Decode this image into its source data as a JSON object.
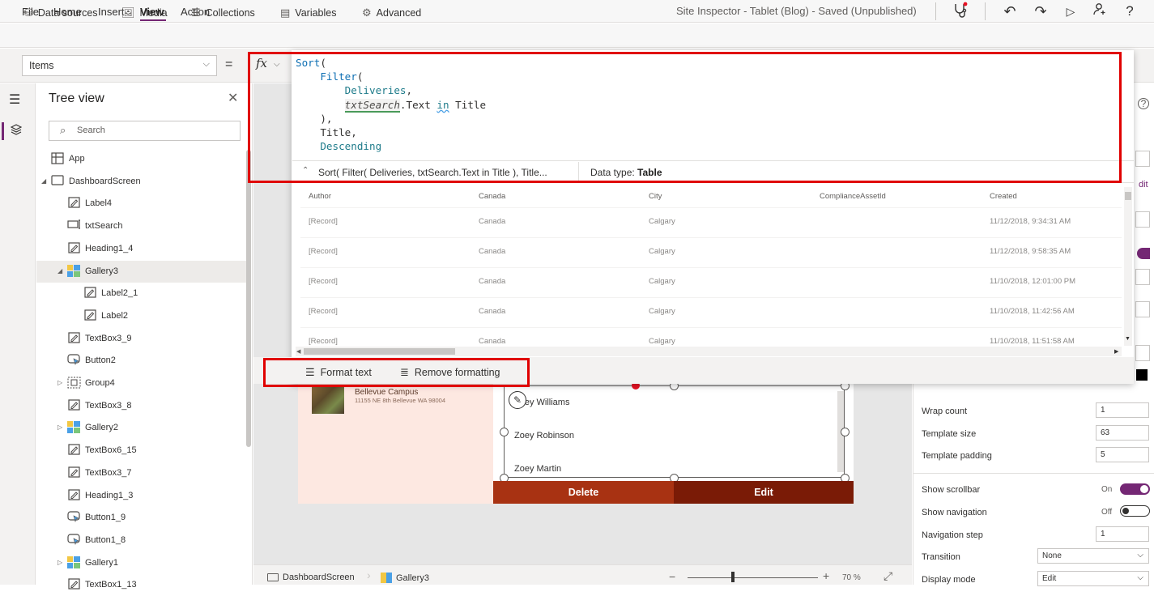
{
  "menubar": {
    "items": [
      "File",
      "Home",
      "Insert",
      "View",
      "Action"
    ],
    "active": "View",
    "doc_title": "Site Inspector - Tablet (Blog) - Saved (Unpublished)"
  },
  "toolbar": {
    "items": [
      {
        "label": "Data sources",
        "icon": "database-icon"
      },
      {
        "label": "Media",
        "icon": "media-icon"
      },
      {
        "label": "Collections",
        "icon": "collections-icon"
      },
      {
        "label": "Variables",
        "icon": "variables-icon"
      },
      {
        "label": "Advanced",
        "icon": "advanced-icon"
      }
    ]
  },
  "formula_bar": {
    "property": "Items",
    "equals": "=",
    "fx": "fx",
    "code_lines": [
      "Sort(",
      "    Filter(",
      "        Deliveries,",
      "        txtSearch.Text in Title",
      "    ),",
      "    Title,",
      "    Descending"
    ],
    "result_expr": "Sort( Filter( Deliveries, txtSearch.Text in Title ), Title...",
    "data_type_label": "Data type:",
    "data_type_value": "Table"
  },
  "result_table": {
    "columns": [
      "Author",
      "Canada",
      "City",
      "ComplianceAssetId",
      "Created"
    ],
    "rows": [
      [
        "[Record]",
        "Canada",
        "Calgary",
        "",
        "11/12/2018, 9:34:31 AM"
      ],
      [
        "[Record]",
        "Canada",
        "Calgary",
        "",
        "11/12/2018, 9:58:35 AM"
      ],
      [
        "[Record]",
        "Canada",
        "Calgary",
        "",
        "11/10/2018, 12:01:00 PM"
      ],
      [
        "[Record]",
        "Canada",
        "Calgary",
        "",
        "11/10/2018, 11:42:56 AM"
      ],
      [
        "[Record]",
        "Canada",
        "Calgary",
        "",
        "11/10/2018, 11:51:58 AM"
      ]
    ]
  },
  "format_bar": {
    "format_text": "Format text",
    "remove_formatting": "Remove formatting"
  },
  "tree": {
    "title": "Tree view",
    "search_placeholder": "Search",
    "items": [
      {
        "label": "App",
        "icon": "app-icon",
        "depth": 0,
        "caret": ""
      },
      {
        "label": "DashboardScreen",
        "icon": "screen-icon",
        "depth": 0,
        "caret": "open"
      },
      {
        "label": "Label4",
        "icon": "label-icon",
        "depth": 1,
        "caret": ""
      },
      {
        "label": "txtSearch",
        "icon": "textinput-icon",
        "depth": 1,
        "caret": ""
      },
      {
        "label": "Heading1_4",
        "icon": "label-icon",
        "depth": 1,
        "caret": ""
      },
      {
        "label": "Gallery3",
        "icon": "gallery-icon",
        "depth": 1,
        "caret": "open",
        "selected": true
      },
      {
        "label": "Label2_1",
        "icon": "label-icon",
        "depth": 2,
        "caret": ""
      },
      {
        "label": "Label2",
        "icon": "label-icon",
        "depth": 2,
        "caret": ""
      },
      {
        "label": "TextBox3_9",
        "icon": "label-icon",
        "depth": 1,
        "caret": ""
      },
      {
        "label": "Button2",
        "icon": "button-icon",
        "depth": 1,
        "caret": ""
      },
      {
        "label": "Group4",
        "icon": "group-icon",
        "depth": 1,
        "caret": "closed"
      },
      {
        "label": "TextBox3_8",
        "icon": "label-icon",
        "depth": 1,
        "caret": ""
      },
      {
        "label": "Gallery2",
        "icon": "gallery-icon",
        "depth": 1,
        "caret": "closed"
      },
      {
        "label": "TextBox6_15",
        "icon": "label-icon",
        "depth": 1,
        "caret": ""
      },
      {
        "label": "TextBox3_7",
        "icon": "label-icon",
        "depth": 1,
        "caret": ""
      },
      {
        "label": "Heading1_3",
        "icon": "label-icon",
        "depth": 1,
        "caret": ""
      },
      {
        "label": "Button1_9",
        "icon": "button-icon",
        "depth": 1,
        "caret": ""
      },
      {
        "label": "Button1_8",
        "icon": "button-icon",
        "depth": 1,
        "caret": ""
      },
      {
        "label": "Gallery1",
        "icon": "gallery-icon",
        "depth": 1,
        "caret": "closed"
      },
      {
        "label": "TextBox1_13",
        "icon": "label-icon",
        "depth": 1,
        "caret": ""
      }
    ]
  },
  "canvas": {
    "card_title": "Bellevue Campus",
    "card_address": "11155 NE 8th Bellevue WA 98004",
    "gallery_names": [
      "Zoey Williams",
      "Zoey Robinson",
      "Zoey Martin"
    ],
    "delete_label": "Delete",
    "edit_label": "Edit"
  },
  "statusbar": {
    "screen": "DashboardScreen",
    "control": "Gallery3",
    "zoom_minus": "−",
    "zoom_plus": "+",
    "zoom_value": "70 %",
    "zoom_level": 0.35
  },
  "properties": {
    "wrap_count_label": "Wrap count",
    "wrap_count": "1",
    "template_size_label": "Template size",
    "template_size": "63",
    "template_padding_label": "Template padding",
    "template_padding": "5",
    "show_scrollbar_label": "Show scrollbar",
    "show_scrollbar_state": "On",
    "show_navigation_label": "Show navigation",
    "show_navigation_state": "Off",
    "navigation_step_label": "Navigation step",
    "navigation_step": "1",
    "transition_label": "Transition",
    "transition": "None",
    "display_mode_label": "Display mode",
    "display_mode": "Edit",
    "edit_link": "dit"
  },
  "colors": {
    "accent": "#742774",
    "highlight_box": "#e00000",
    "delete_button": "#a83212",
    "edit_button": "#7a1b06"
  }
}
